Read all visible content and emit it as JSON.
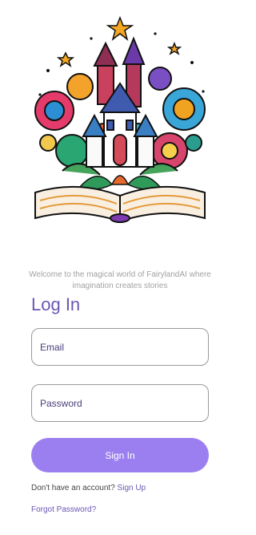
{
  "hero": {
    "image_name": "fairytale-castle-book-illustration"
  },
  "tagline": "Welcome to the magical world of FairylandAI where imagination creates stories",
  "title": "Log In",
  "form": {
    "email_placeholder": "Email",
    "password_placeholder": "Password",
    "signin_label": "Sign In"
  },
  "footer": {
    "no_account_text": "Don't have an account?",
    "signup_label": "Sign Up",
    "forgot_label": "Forgot Password?"
  },
  "colors": {
    "accent": "#6b57b3",
    "button": "#9b7ff0",
    "tagline": "#a2a2a2",
    "border": "#9a9a9a"
  }
}
